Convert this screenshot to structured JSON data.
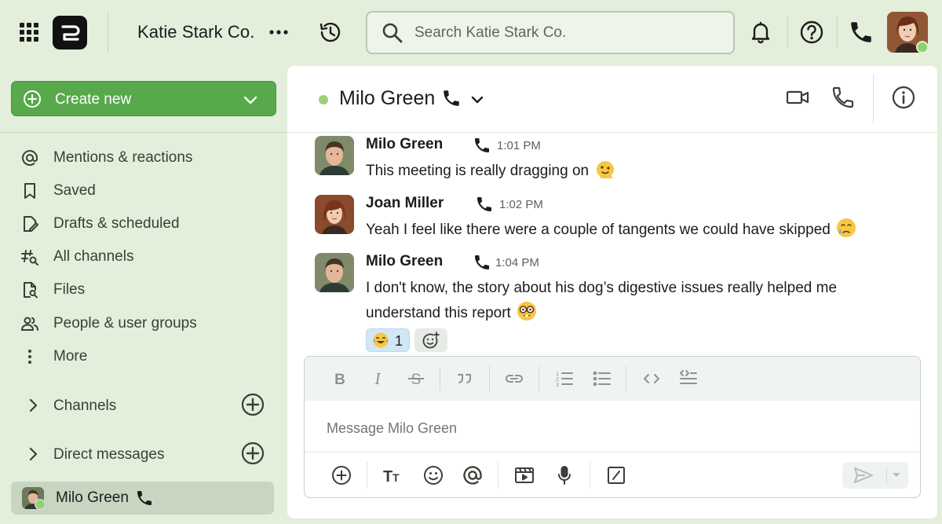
{
  "topbar": {
    "workspace_name": "Katie Stark Co.",
    "search_placeholder": "Search Katie Stark Co.",
    "icons": [
      "grid-menu-icon",
      "app-logo",
      "more-dots-icon",
      "history-icon",
      "search-icon",
      "bell-icon",
      "help-icon",
      "phone-icon"
    ]
  },
  "sidebar": {
    "create_label": "Create new",
    "items": [
      {
        "label": "Mentions & reactions",
        "icon": "at-icon"
      },
      {
        "label": "Saved",
        "icon": "bookmark-icon"
      },
      {
        "label": "Drafts & scheduled",
        "icon": "draft-icon"
      },
      {
        "label": "All channels",
        "icon": "hash-search-icon"
      },
      {
        "label": "Files",
        "icon": "file-search-icon"
      },
      {
        "label": "People & user groups",
        "icon": "people-icon"
      },
      {
        "label": "More",
        "icon": "vertical-dots-icon"
      }
    ],
    "sections": [
      {
        "label": "Channels"
      },
      {
        "label": "Direct messages"
      }
    ],
    "active_dm": {
      "label": "Milo Green"
    }
  },
  "channel": {
    "name": "Milo Green",
    "status": "online"
  },
  "messages": [
    {
      "author": "Milo Green",
      "time": "1:01 PM",
      "text": "This meeting is really dragging on",
      "emoji": "melting-face"
    },
    {
      "author": "Joan Miller",
      "time": "1:02 PM",
      "text": "Yeah I feel like there were a couple of tangents we could have skipped",
      "emoji": "face-holding-back-tears"
    },
    {
      "author": "Milo Green",
      "time": "1:04 PM",
      "text": "I don't know, the story about his dog’s digestive issues really helped me understand this report",
      "emoji": "nerd-face"
    }
  ],
  "reactions": [
    {
      "emoji": "face-with-tears-of-joy",
      "count": "1"
    }
  ],
  "composer": {
    "placeholder": "Message Milo Green"
  },
  "colors": {
    "background": "#e3eedb",
    "accent_green": "#57a94c",
    "presence_green": "#8fd16a",
    "active_item": "#c8d6c1"
  }
}
